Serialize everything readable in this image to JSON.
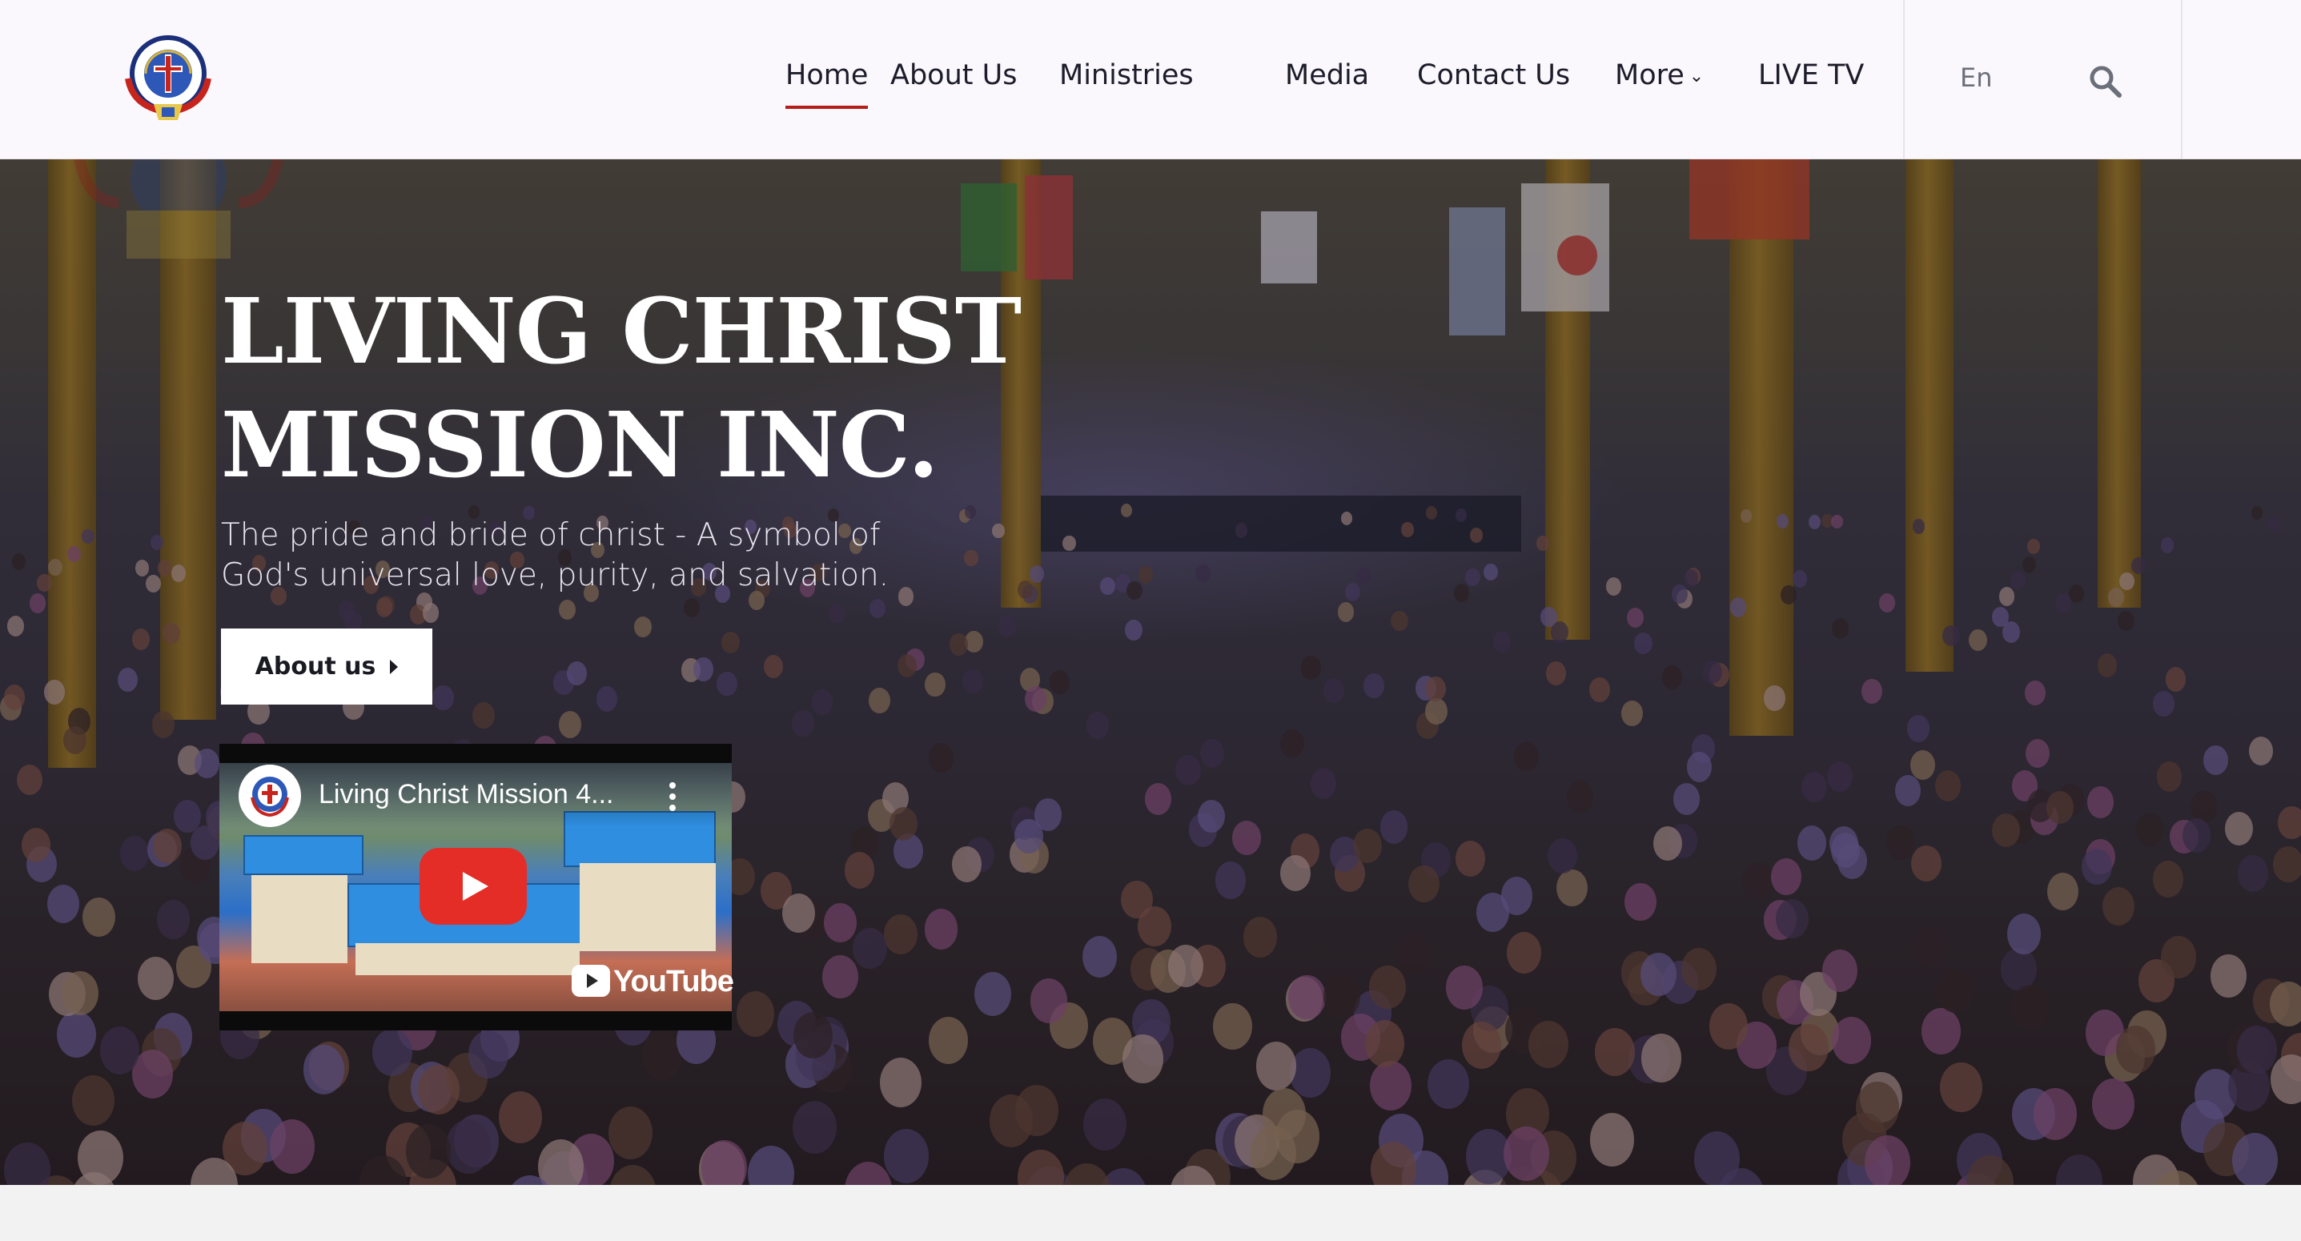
{
  "header": {
    "logo_text": "LIVING CHRIST MISSION INC",
    "nav": [
      {
        "label": "Home",
        "active": true
      },
      {
        "label": "About Us",
        "active": false
      },
      {
        "label": "Ministries",
        "active": false
      },
      {
        "label": "Media",
        "active": false
      },
      {
        "label": "Contact Us",
        "active": false
      },
      {
        "label": "More",
        "active": false
      },
      {
        "label": "LIVE TV",
        "active": false
      }
    ],
    "language": "En",
    "search_icon": "search-icon"
  },
  "hero": {
    "title_line1": "LIVING CHRIST",
    "title_line2": "MISSION INC.",
    "subtitle_line1": "The pride and bride of christ - A symbol of",
    "subtitle_line2": "God's universal love, purity, and salvation.",
    "button_label": "About us"
  },
  "video": {
    "title": "Living Christ Mission 4...",
    "platform": "YouTube"
  },
  "colors": {
    "accent": "#b5201b",
    "header_bg": "#fbf8fd",
    "nav_text": "#1c1c2a",
    "youtube_red": "#ff0000"
  }
}
